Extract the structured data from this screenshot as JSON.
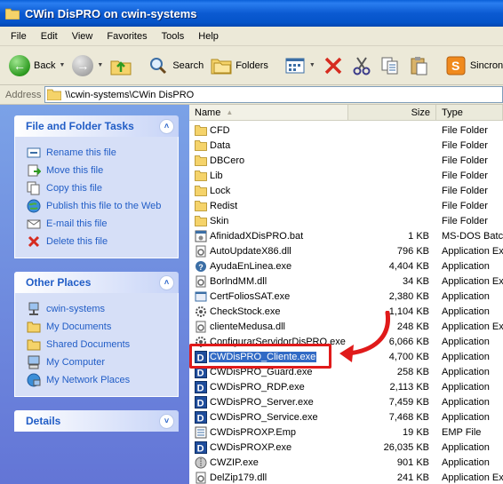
{
  "window": {
    "title": "CWin DisPRO on cwin-systems"
  },
  "menu": [
    "File",
    "Edit",
    "View",
    "Favorites",
    "Tools",
    "Help"
  ],
  "toolbar": {
    "back_label": "Back",
    "search_label": "Search",
    "folders_label": "Folders",
    "sincro_label": "Sincron"
  },
  "address": {
    "label": "Address",
    "value": "\\\\cwin-systems\\CWin DisPRO"
  },
  "tasks_panel": {
    "title": "File and Folder Tasks",
    "items": [
      {
        "label": "Rename this file",
        "icon": "rename-icon"
      },
      {
        "label": "Move this file",
        "icon": "move-icon"
      },
      {
        "label": "Copy this file",
        "icon": "copy-icon"
      },
      {
        "label": "Publish this file to the Web",
        "icon": "publish-icon"
      },
      {
        "label": "E-mail this file",
        "icon": "email-icon"
      },
      {
        "label": "Delete this file",
        "icon": "delete-icon"
      }
    ]
  },
  "places_panel": {
    "title": "Other Places",
    "items": [
      {
        "label": "cwin-systems",
        "icon": "network-computer-icon"
      },
      {
        "label": "My Documents",
        "icon": "folder-icon"
      },
      {
        "label": "Shared Documents",
        "icon": "folder-icon"
      },
      {
        "label": "My Computer",
        "icon": "computer-icon"
      },
      {
        "label": "My Network Places",
        "icon": "network-icon"
      }
    ]
  },
  "details_panel": {
    "title": "Details"
  },
  "columns": {
    "name": "Name",
    "size": "Size",
    "type": "Type"
  },
  "files": [
    {
      "name": "CFD",
      "size": "",
      "type": "File Folder",
      "icon": "folder"
    },
    {
      "name": "Data",
      "size": "",
      "type": "File Folder",
      "icon": "folder"
    },
    {
      "name": "DBCero",
      "size": "",
      "type": "File Folder",
      "icon": "folder"
    },
    {
      "name": "Lib",
      "size": "",
      "type": "File Folder",
      "icon": "folder"
    },
    {
      "name": "Lock",
      "size": "",
      "type": "File Folder",
      "icon": "folder"
    },
    {
      "name": "Redist",
      "size": "",
      "type": "File Folder",
      "icon": "folder"
    },
    {
      "name": "Skin",
      "size": "",
      "type": "File Folder",
      "icon": "folder"
    },
    {
      "name": "AfinidadXDisPRO.bat",
      "size": "1 KB",
      "type": "MS-DOS Batch",
      "icon": "bat"
    },
    {
      "name": "AutoUpdateX86.dll",
      "size": "796 KB",
      "type": "Application Ext",
      "icon": "dll"
    },
    {
      "name": "AyudaEnLinea.exe",
      "size": "4,404 KB",
      "type": "Application",
      "icon": "help"
    },
    {
      "name": "BorlndMM.dll",
      "size": "34 KB",
      "type": "Application Ext",
      "icon": "dll"
    },
    {
      "name": "CertFoliosSAT.exe",
      "size": "2,380 KB",
      "type": "Application",
      "icon": "exe"
    },
    {
      "name": "CheckStock.exe",
      "size": "1,104 KB",
      "type": "Application",
      "icon": "gear"
    },
    {
      "name": "clienteMedusa.dll",
      "size": "248 KB",
      "type": "Application Ext",
      "icon": "dll"
    },
    {
      "name": "ConfigurarServidorDisPRO.exe",
      "size": "6,066 KB",
      "type": "Application",
      "icon": "gear"
    },
    {
      "name": "CWDisPRO_Cliente.exe",
      "size": "4,700 KB",
      "type": "Application",
      "icon": "d",
      "selected": true
    },
    {
      "name": "CWDisPRO_Guard.exe",
      "size": "258 KB",
      "type": "Application",
      "icon": "d"
    },
    {
      "name": "CWDisPRO_RDP.exe",
      "size": "2,113 KB",
      "type": "Application",
      "icon": "d"
    },
    {
      "name": "CWDisPRO_Server.exe",
      "size": "7,459 KB",
      "type": "Application",
      "icon": "d"
    },
    {
      "name": "CWDisPRO_Service.exe",
      "size": "7,468 KB",
      "type": "Application",
      "icon": "d"
    },
    {
      "name": "CWDisPROXP.Emp",
      "size": "19 KB",
      "type": "EMP File",
      "icon": "emp"
    },
    {
      "name": "CWDisPROXP.exe",
      "size": "26,035 KB",
      "type": "Application",
      "icon": "d"
    },
    {
      "name": "CWZIP.exe",
      "size": "901 KB",
      "type": "Application",
      "icon": "zip"
    },
    {
      "name": "DelZip179.dll",
      "size": "241 KB",
      "type": "Application Ext",
      "icon": "dll"
    }
  ],
  "colors": {
    "selection": "#316ac5",
    "highlight": "#e01a1a",
    "link": "#215dc6"
  }
}
